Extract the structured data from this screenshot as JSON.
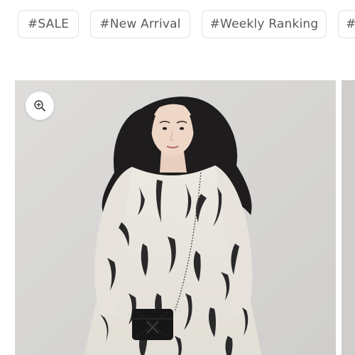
{
  "tags": [
    {
      "label": "#SALE"
    },
    {
      "label": "#New Arrival"
    },
    {
      "label": "#Weekly Ranking"
    },
    {
      "label": "#"
    }
  ],
  "product": {
    "zoom_icon": "zoom-in-icon",
    "image": "model-in-black-and-white-tie-dye-dress"
  },
  "colors": {
    "tag_border": "#e3e3e3",
    "tag_text": "#5a5a5a",
    "image_background": "#d7d6d4"
  }
}
